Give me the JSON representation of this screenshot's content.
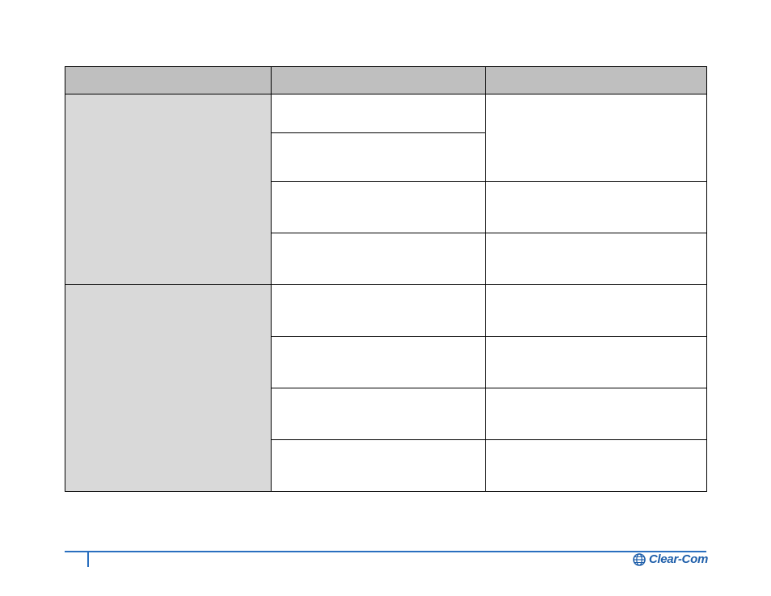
{
  "table": {
    "headers": [
      "",
      "",
      ""
    ],
    "groups": [
      {
        "label": "",
        "rows": [
          {
            "h": "r-h48",
            "c2": "",
            "c3": "",
            "merge_c3_with_next": true
          },
          {
            "h": "r-h60",
            "c2": "",
            "c3": ""
          },
          {
            "h": "r-h64",
            "c2": "",
            "c3": ""
          },
          {
            "h": "r-h64",
            "c2": "",
            "c3": ""
          }
        ]
      },
      {
        "label": "",
        "rows": [
          {
            "h": "r-h64",
            "c2": "",
            "c3": ""
          },
          {
            "h": "r-h64",
            "c2": "",
            "c3": ""
          },
          {
            "h": "r-h64",
            "c2": "",
            "c3": ""
          },
          {
            "h": "r-h64",
            "c2": "",
            "c3": ""
          }
        ]
      }
    ]
  },
  "footer": {
    "page_number": "",
    "doc_title": "",
    "brand": "Clear-Com"
  },
  "colors": {
    "accent": "#2a6fbf",
    "shaded": "#d9d9d9",
    "header_bg": "#bfbfbf"
  }
}
